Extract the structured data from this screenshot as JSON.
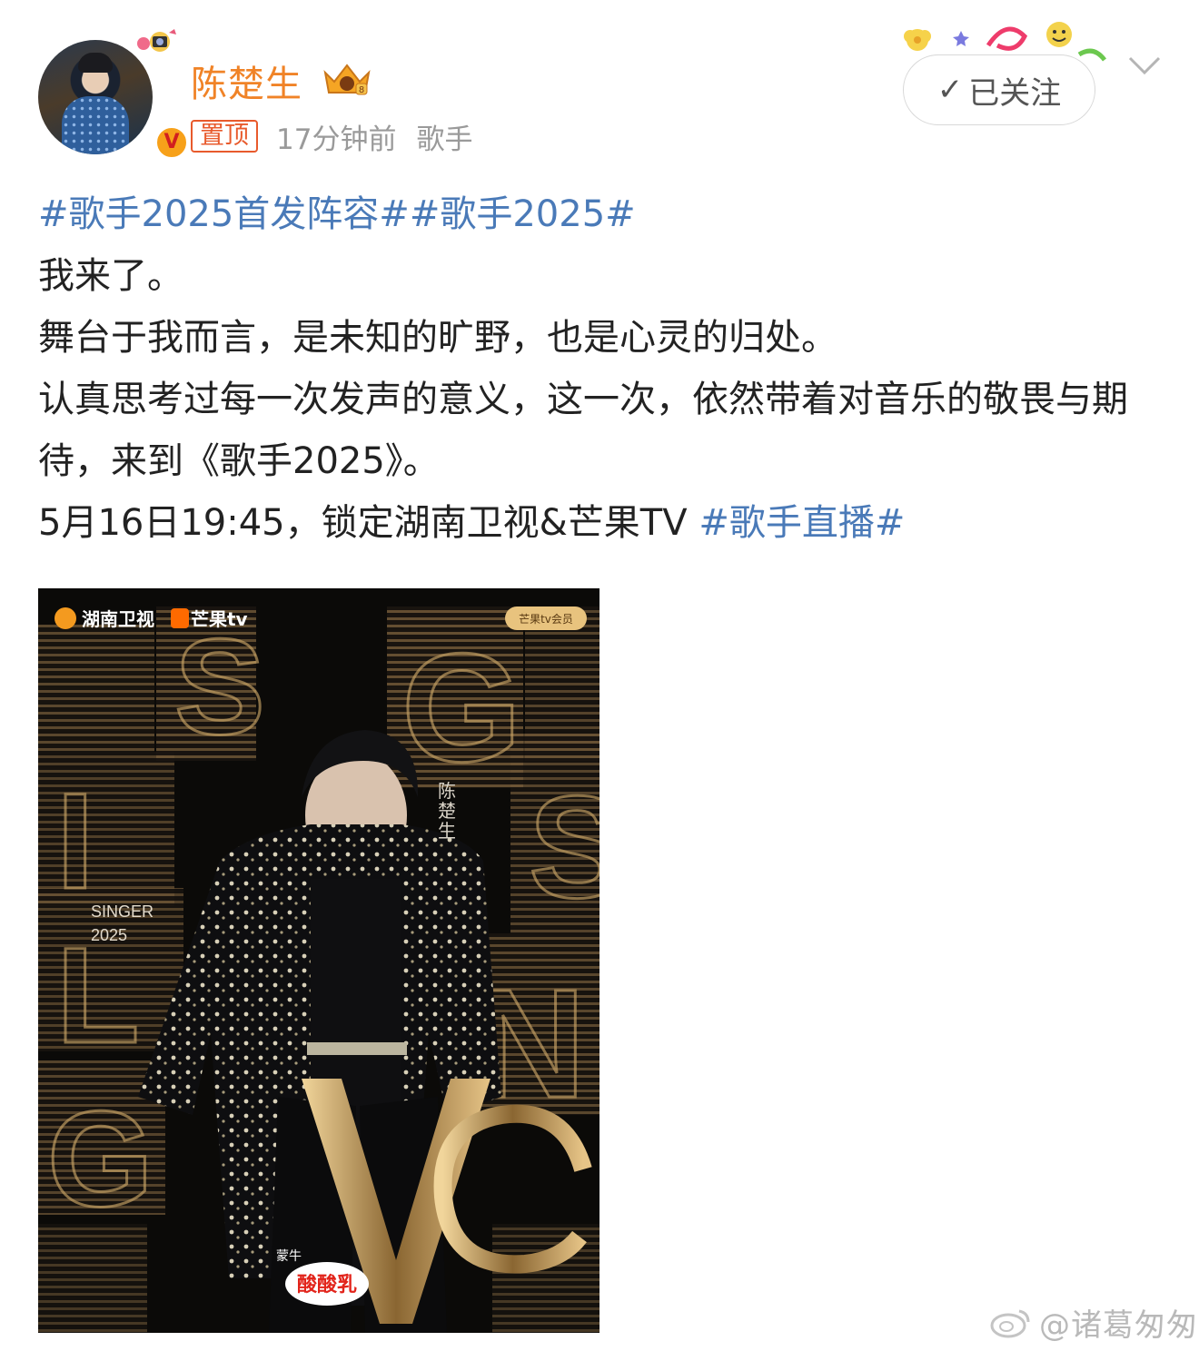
{
  "post": {
    "username": "陈楚生",
    "pin_label": "置顶",
    "time": "17分钟前",
    "source": "歌手",
    "follow_label": "已关注",
    "topic1": "#歌手2025首发阵容#",
    "topic2": "#歌手2025#",
    "line1": "我来了。",
    "line2": "舞台于我而言，是未知的旷野，也是心灵的归处。",
    "line3": "认真思考过每一次发声的意义，这一次，依然带着对音乐的敬畏与期待，来到《歌手2025》。",
    "line4_text": "5月16日19:45，锁定湖南卫视&芒果TV ",
    "line4_topic": "#歌手直播#"
  },
  "poster": {
    "logo_hunan": "湖南卫视",
    "logo_mango": "芒果tv",
    "badge_member": "芒果tv会员",
    "singer_name_vertical": "陈楚生",
    "singer_label_1": "SINGER",
    "singer_label_2": "2025",
    "sponsor_small": "蒙牛",
    "sponsor": "酸酸乳"
  },
  "watermark": "@诸葛匆匆",
  "colors": {
    "username": "#f08327",
    "topic": "#4a7ab8",
    "pin": "#e85a2c",
    "meta": "#9a9a9a",
    "poster_gold": "#b9935a"
  },
  "icons": [
    "verified-v-icon",
    "vip-crown-icon",
    "check-icon",
    "chevron-down-icon",
    "weibo-logo-icon"
  ]
}
